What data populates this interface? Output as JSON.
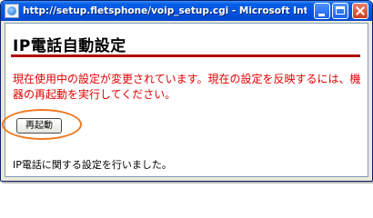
{
  "window": {
    "title": "http://setup.fletsphone/voip_setup.cgi - Microsoft Internet...",
    "minimize_label": "_",
    "maximize_label": "□",
    "close_label": "×"
  },
  "page": {
    "heading": "IP電話自動設定",
    "notice": "現在使用中の設定が変更されています。現在の設定を反映するには、機器の再起動を実行してください。",
    "restart_button": "再起動",
    "status": "IP電話に関する設定を行いました。"
  },
  "colors": {
    "titlebar": "#0054e3",
    "rule": "#b00000",
    "notice_text": "#e00000",
    "highlight": "#f07820"
  },
  "icons": [
    "browser-icon",
    "minimize-icon",
    "maximize-icon",
    "close-icon"
  ]
}
